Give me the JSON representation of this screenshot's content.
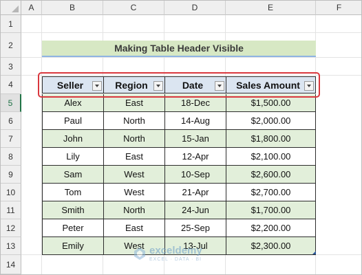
{
  "columns": [
    "A",
    "B",
    "C",
    "D",
    "E",
    "F"
  ],
  "rows": [
    "1",
    "2",
    "3",
    "4",
    "5",
    "6",
    "7",
    "8",
    "9",
    "10",
    "11",
    "12",
    "13",
    "14"
  ],
  "title": "Making Table Header Visible",
  "table": {
    "headers": [
      "Seller",
      "Region",
      "Date",
      "Sales Amount"
    ],
    "data": [
      [
        "Alex",
        "East",
        "18-Dec",
        "$1,500.00"
      ],
      [
        "Paul",
        "North",
        "14-Aug",
        "$2,000.00"
      ],
      [
        "John",
        "North",
        "15-Jan",
        "$1,800.00"
      ],
      [
        "Lily",
        "East",
        "12-Apr",
        "$2,100.00"
      ],
      [
        "Sam",
        "West",
        "10-Sep",
        "$2,600.00"
      ],
      [
        "Tom",
        "West",
        "21-Apr",
        "$2,700.00"
      ],
      [
        "Smith",
        "North",
        "24-Jun",
        "$1,700.00"
      ],
      [
        "Peter",
        "East",
        "25-Sep",
        "$2,200.00"
      ],
      [
        "Emily",
        "West",
        "13-Jul",
        "$2,300.00"
      ]
    ]
  },
  "active_row": "5",
  "watermark": {
    "name": "exceldemy",
    "sub": "EXCEL · DATA · BI"
  },
  "colors": {
    "highlight": "#d9373d",
    "band": "#e2efda",
    "header_fill": "#dbe5f1",
    "title_fill": "#d7e8c4"
  }
}
